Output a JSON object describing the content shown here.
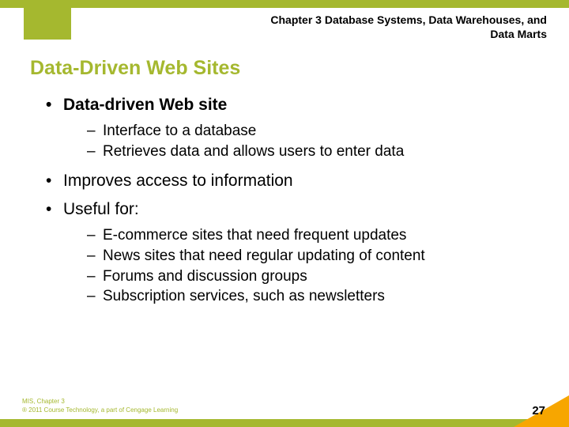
{
  "header": {
    "chapter_line1": "Chapter 3 Database Systems, Data Warehouses, and",
    "chapter_line2": "Data Marts"
  },
  "title": "Data-Driven Web Sites",
  "bullets": {
    "b1": "Data-driven Web site",
    "b1_sub1": "Interface to a database",
    "b1_sub2": "Retrieves data and allows users to enter data",
    "b2": "Improves access to information",
    "b3": "Useful for:",
    "b3_sub1": "E-commerce sites that need frequent updates",
    "b3_sub2": "News sites that need regular updating of content",
    "b3_sub3": "Forums and discussion groups",
    "b3_sub4": "Subscription services, such as newsletters"
  },
  "footer": {
    "line1": "MIS, Chapter 3",
    "line2": "® 2011 Course Technology, a part of Cengage Learning",
    "page": "27"
  }
}
